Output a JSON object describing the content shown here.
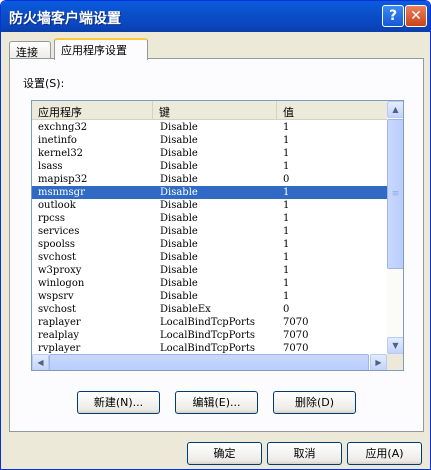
{
  "window": {
    "title": "防火墙客户端设置",
    "help_glyph": "?",
    "close_glyph": "✕"
  },
  "tabs": [
    {
      "label": "连接"
    },
    {
      "label": "应用程序设置"
    }
  ],
  "settings_label": "设置(S):",
  "list": {
    "columns": [
      "应用程序",
      "键",
      "值"
    ],
    "rows": [
      {
        "app": "exchng32",
        "key": "Disable",
        "value": "1"
      },
      {
        "app": "inetinfo",
        "key": "Disable",
        "value": "1"
      },
      {
        "app": "kernel32",
        "key": "Disable",
        "value": "1"
      },
      {
        "app": "lsass",
        "key": "Disable",
        "value": "1"
      },
      {
        "app": "mapisp32",
        "key": "Disable",
        "value": "0"
      },
      {
        "app": "msnmsgr",
        "key": "Disable",
        "value": "1"
      },
      {
        "app": "outlook",
        "key": "Disable",
        "value": "1"
      },
      {
        "app": "rpcss",
        "key": "Disable",
        "value": "1"
      },
      {
        "app": "services",
        "key": "Disable",
        "value": "1"
      },
      {
        "app": "spoolss",
        "key": "Disable",
        "value": "1"
      },
      {
        "app": "svchost",
        "key": "Disable",
        "value": "1"
      },
      {
        "app": "w3proxy",
        "key": "Disable",
        "value": "1"
      },
      {
        "app": "winlogon",
        "key": "Disable",
        "value": "1"
      },
      {
        "app": "wspsrv",
        "key": "Disable",
        "value": "1"
      },
      {
        "app": "svchost",
        "key": "DisableEx",
        "value": "0"
      },
      {
        "app": "raplayer",
        "key": "LocalBindTcpPorts",
        "value": "7070"
      },
      {
        "app": "realplay",
        "key": "LocalBindTcpPorts",
        "value": "7070"
      },
      {
        "app": "rvplayer",
        "key": "LocalBindTcpPorts",
        "value": "7070"
      }
    ],
    "selected_index": 5
  },
  "buttons": {
    "new": "新建(N)...",
    "edit": "编辑(E)...",
    "delete": "删除(D)",
    "ok": "确定",
    "cancel": "取消",
    "apply": "应用(A)"
  },
  "colors": {
    "selection": "#316ac5",
    "titlebar": "#0a5be0"
  }
}
